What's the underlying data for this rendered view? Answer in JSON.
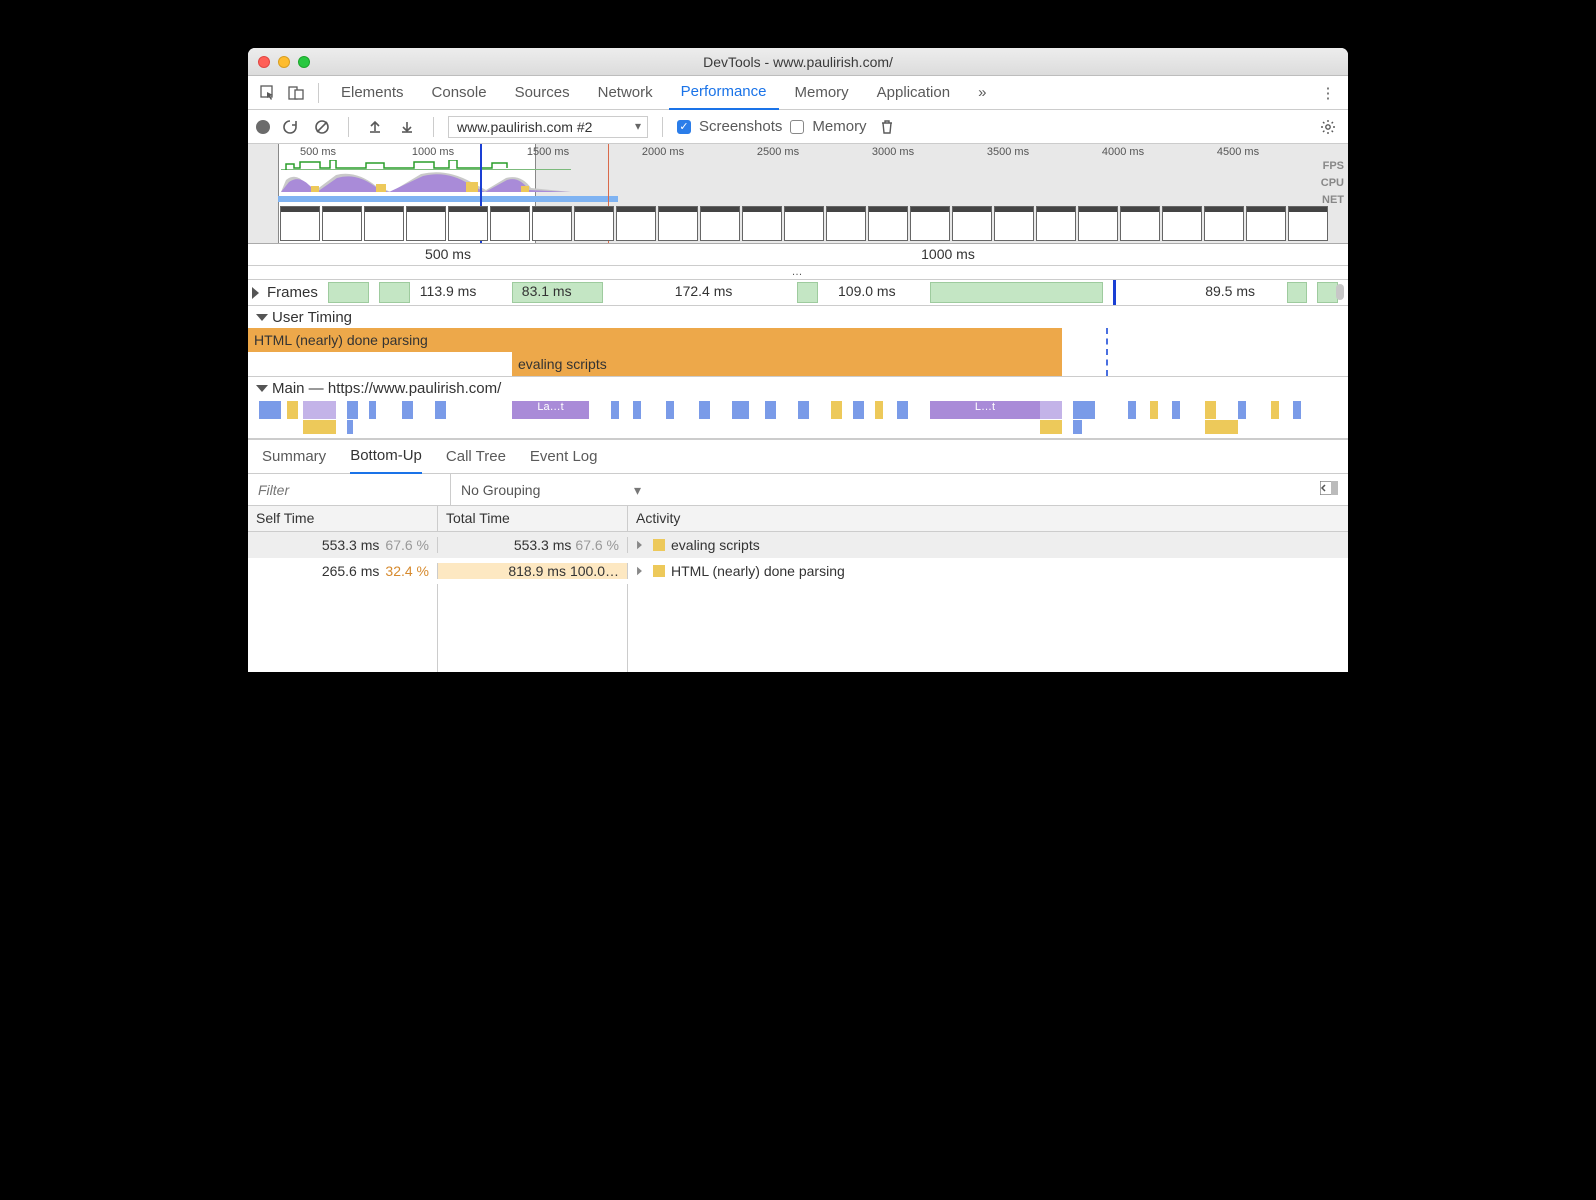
{
  "window": {
    "title": "DevTools - www.paulirish.com/"
  },
  "panelTabs": {
    "items": [
      "Elements",
      "Console",
      "Sources",
      "Network",
      "Performance",
      "Memory",
      "Application"
    ],
    "overflow": "»",
    "active": "Performance"
  },
  "toolbar": {
    "profileSelect": "www.paulirish.com #2",
    "screenshots": {
      "label": "Screenshots",
      "checked": true
    },
    "memory": {
      "label": "Memory",
      "checked": false
    }
  },
  "overview": {
    "ticks": [
      "500 ms",
      "1000 ms",
      "1500 ms",
      "2000 ms",
      "2500 ms",
      "3000 ms",
      "3500 ms",
      "4000 ms",
      "4500 ms"
    ],
    "sideLabels": [
      "FPS",
      "CPU",
      "NET"
    ],
    "selectedRange": {
      "startPct": 3,
      "widthPct": 23
    },
    "markers": {
      "bluePct": 21,
      "redPct": 33
    }
  },
  "ruler": {
    "ticks": [
      "500 ms",
      "1000 ms"
    ]
  },
  "frames": {
    "header": "Frames",
    "items": [
      {
        "label": "113.9 ms",
        "leftPct": 0,
        "widthPct": 18
      },
      {
        "label": "83.1 ms",
        "leftPct": 18,
        "widthPct": 10
      },
      {
        "label": "172.4 ms",
        "leftPct": 32,
        "widthPct": 18
      },
      {
        "label": "109.0 ms",
        "leftPct": 52,
        "widthPct": 12
      },
      {
        "label": "89.5 ms",
        "leftPct": 86,
        "widthPct": 10
      }
    ],
    "markerPct": 78
  },
  "userTiming": {
    "header": "User Timing",
    "bars": [
      {
        "label": "HTML (nearly) done parsing",
        "leftPct": 0,
        "widthPct": 74
      },
      {
        "label": "evaling scripts",
        "leftPct": 24,
        "widthPct": 50
      }
    ],
    "dashedPct": 78
  },
  "main": {
    "header": "Main — https://www.paulirish.com/",
    "purpleLabels": [
      "La…t",
      "L…t"
    ]
  },
  "bottomTabs": {
    "items": [
      "Summary",
      "Bottom-Up",
      "Call Tree",
      "Event Log"
    ],
    "active": "Bottom-Up"
  },
  "filter": {
    "placeholder": "Filter",
    "grouping": "No Grouping"
  },
  "table": {
    "headers": {
      "self": "Self Time",
      "total": "Total Time",
      "activity": "Activity"
    },
    "rows": [
      {
        "selfMs": "553.3 ms",
        "selfPct": "67.6 %",
        "totalMs": "553.3 ms",
        "totalPct": "67.6 %",
        "barPct": 0,
        "activity": "evaling scripts",
        "selected": true
      },
      {
        "selfMs": "265.6 ms",
        "selfPct": "32.4 %",
        "totalMs": "818.9 ms",
        "totalPct": "100.0…",
        "barPct": 100,
        "activity": "HTML (nearly) done parsing",
        "selected": false
      }
    ]
  }
}
